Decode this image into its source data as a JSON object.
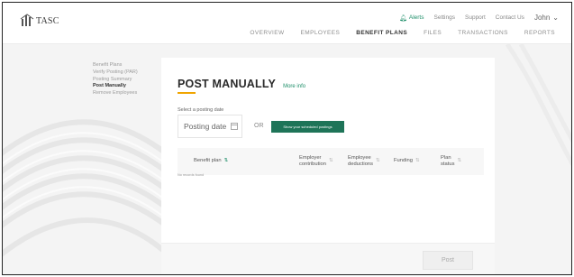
{
  "header": {
    "logo_text": "TASC",
    "util": {
      "alerts": "Alerts",
      "settings": "Settings",
      "support": "Support",
      "contact": "Contact Us",
      "user": "John"
    },
    "nav": [
      "OVERVIEW",
      "EMPLOYEES",
      "BENEFIT PLANS",
      "FILES",
      "TRANSACTIONS",
      "REPORTS"
    ],
    "active_nav": "BENEFIT PLANS"
  },
  "sidebar": {
    "items": [
      "Benefit Plans",
      "Verify Posting (PAR)",
      "Posting Summary",
      "Post Manually",
      "Remove Employees"
    ],
    "current": "Post Manually"
  },
  "main": {
    "title": "POST MANUALLY",
    "more_info": "More info",
    "select_label": "Select a posting date",
    "date_placeholder": "Posting date",
    "or": "OR",
    "schedule_button": "Show your scheduled postings",
    "columns": {
      "plan": "Benefit plan",
      "employer_1": "Employer",
      "employer_2": "contribution",
      "deductions_1": "Employee",
      "deductions_2": "deductions",
      "funding": "Funding",
      "status_1": "Plan",
      "status_2": "status"
    },
    "empty_text": "No records found",
    "post_button": "Post"
  },
  "colors": {
    "accent_green": "#1e7458",
    "accent_orange": "#f0a500"
  }
}
